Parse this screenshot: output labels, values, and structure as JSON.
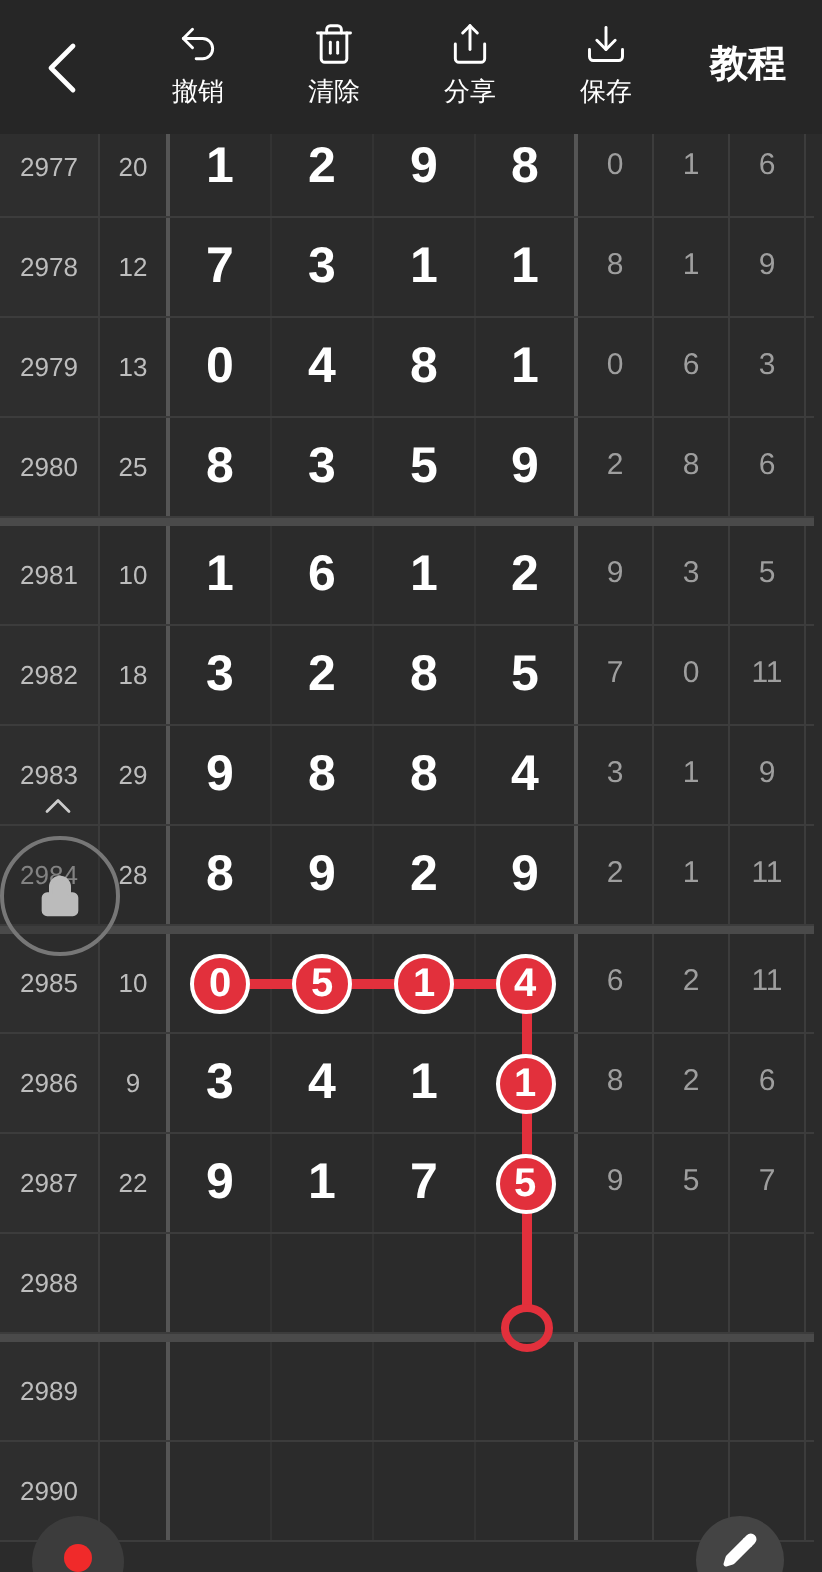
{
  "header": {
    "actions": [
      {
        "kind": "undo",
        "label": "撤销"
      },
      {
        "kind": "clear",
        "label": "清除"
      },
      {
        "kind": "share",
        "label": "分享"
      },
      {
        "kind": "save",
        "label": "保存"
      }
    ],
    "tutorial": "教程"
  },
  "rows": [
    {
      "issue": "2977",
      "sum": "20",
      "digits": [
        {
          "value": "1",
          "circled": false
        },
        {
          "value": "2",
          "circled": false
        },
        {
          "value": "9",
          "circled": false
        },
        {
          "value": "8",
          "circled": false
        }
      ],
      "stats": [
        "0",
        "1",
        "6"
      ]
    },
    {
      "issue": "2978",
      "sum": "12",
      "digits": [
        {
          "value": "7",
          "circled": false
        },
        {
          "value": "3",
          "circled": false
        },
        {
          "value": "1",
          "circled": false
        },
        {
          "value": "1",
          "circled": false
        }
      ],
      "stats": [
        "8",
        "1",
        "9"
      ]
    },
    {
      "issue": "2979",
      "sum": "13",
      "digits": [
        {
          "value": "0",
          "circled": false
        },
        {
          "value": "4",
          "circled": false
        },
        {
          "value": "8",
          "circled": false
        },
        {
          "value": "1",
          "circled": false
        }
      ],
      "stats": [
        "0",
        "6",
        "3"
      ]
    },
    {
      "issue": "2980",
      "sum": "25",
      "digits": [
        {
          "value": "8",
          "circled": false
        },
        {
          "value": "3",
          "circled": false
        },
        {
          "value": "5",
          "circled": false
        },
        {
          "value": "9",
          "circled": false
        }
      ],
      "stats": [
        "2",
        "8",
        "6"
      ]
    },
    {
      "issue": "2981",
      "sum": "10",
      "digits": [
        {
          "value": "1",
          "circled": false
        },
        {
          "value": "6",
          "circled": false
        },
        {
          "value": "1",
          "circled": false
        },
        {
          "value": "2",
          "circled": false
        }
      ],
      "stats": [
        "9",
        "3",
        "5"
      ]
    },
    {
      "issue": "2982",
      "sum": "18",
      "digits": [
        {
          "value": "3",
          "circled": false
        },
        {
          "value": "2",
          "circled": false
        },
        {
          "value": "8",
          "circled": false
        },
        {
          "value": "5",
          "circled": false
        }
      ],
      "stats": [
        "7",
        "0",
        "11"
      ]
    },
    {
      "issue": "2983",
      "sum": "29",
      "digits": [
        {
          "value": "9",
          "circled": false
        },
        {
          "value": "8",
          "circled": false
        },
        {
          "value": "8",
          "circled": false
        },
        {
          "value": "4",
          "circled": false
        }
      ],
      "stats": [
        "3",
        "1",
        "9"
      ]
    },
    {
      "issue": "2984",
      "sum": "28",
      "digits": [
        {
          "value": "8",
          "circled": false
        },
        {
          "value": "9",
          "circled": false
        },
        {
          "value": "2",
          "circled": false
        },
        {
          "value": "9",
          "circled": false
        }
      ],
      "stats": [
        "2",
        "1",
        "11"
      ]
    },
    {
      "issue": "2985",
      "sum": "10",
      "digits": [
        {
          "value": "0",
          "circled": true
        },
        {
          "value": "5",
          "circled": true
        },
        {
          "value": "1",
          "circled": true
        },
        {
          "value": "4",
          "circled": true
        }
      ],
      "stats": [
        "6",
        "2",
        "11"
      ]
    },
    {
      "issue": "2986",
      "sum": "9",
      "digits": [
        {
          "value": "3",
          "circled": false
        },
        {
          "value": "4",
          "circled": false
        },
        {
          "value": "1",
          "circled": false
        },
        {
          "value": "1",
          "circled": true
        }
      ],
      "stats": [
        "8",
        "2",
        "6"
      ]
    },
    {
      "issue": "2987",
      "sum": "22",
      "digits": [
        {
          "value": "9",
          "circled": false
        },
        {
          "value": "1",
          "circled": false
        },
        {
          "value": "7",
          "circled": false
        },
        {
          "value": "5",
          "circled": true
        }
      ],
      "stats": [
        "9",
        "5",
        "7"
      ]
    },
    {
      "issue": "2988"
    },
    {
      "issue": "2989"
    },
    {
      "issue": "2990"
    }
  ]
}
